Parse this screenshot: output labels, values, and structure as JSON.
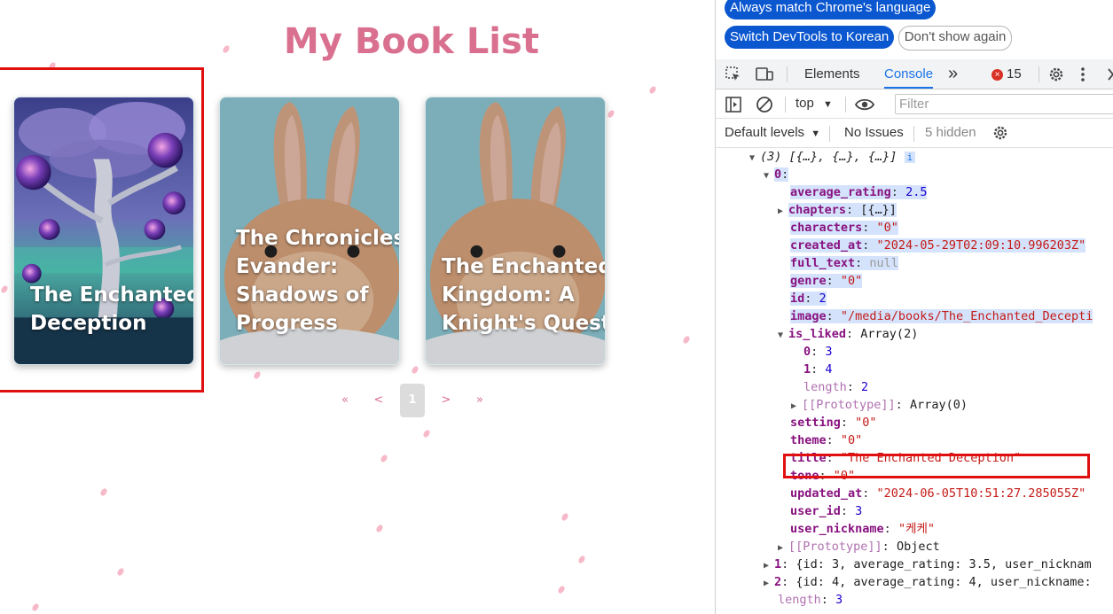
{
  "app": {
    "title": "My Book List",
    "books": [
      {
        "title": "The Enchanted\nDeception",
        "cover": "fantasy-tree-cover"
      },
      {
        "title": "The Chronicles of\nEvander:\nShadows of\nProgress",
        "cover": "rabbit-cover"
      },
      {
        "title": "The Enchanted\nKingdom: A\nKnight's Quest",
        "cover": "rabbit-cover"
      }
    ],
    "pagination": {
      "first": "«",
      "prev": "<",
      "current": "1",
      "next": ">",
      "last": "»"
    }
  },
  "devtools": {
    "banner": {
      "always_match": "Always match Chrome's language",
      "switch_korean": "Switch DevTools to Korean",
      "dont_show": "Don't show again"
    },
    "tabs": {
      "elements": "Elements",
      "console": "Console",
      "more": "»",
      "error_count": "15"
    },
    "toolbar": {
      "context": "top",
      "filter_placeholder": "Filter"
    },
    "levels": {
      "default_levels": "Default levels",
      "no_issues": "No Issues",
      "hidden": "5 hidden"
    },
    "console": {
      "array_summary": "(3) [{…}, {…}, {…}]",
      "index0": "0",
      "props": [
        {
          "key": "average_rating",
          "value": "2.5",
          "kind": "num"
        },
        {
          "key": "chapters",
          "value": "[{…}]",
          "kind": "obj",
          "expandable": true
        },
        {
          "key": "characters",
          "value": "\"0\"",
          "kind": "str"
        },
        {
          "key": "created_at",
          "value": "\"2024-05-29T02:09:10.996203Z\"",
          "kind": "str"
        },
        {
          "key": "full_text",
          "value": "null",
          "kind": "nul"
        },
        {
          "key": "genre",
          "value": "\"0\"",
          "kind": "str"
        },
        {
          "key": "id",
          "value": "2",
          "kind": "num"
        },
        {
          "key": "image",
          "value": "\"/media/books/The_Enchanted_Decepti",
          "kind": "str"
        }
      ],
      "is_liked": {
        "key": "is_liked",
        "value": "Array(2)",
        "items": [
          {
            "key": "0",
            "value": "3"
          },
          {
            "key": "1",
            "value": "4"
          },
          {
            "key": "length",
            "value": "2"
          }
        ],
        "prototype": "[[Prototype]]",
        "prototype_value": "Array(0)"
      },
      "props2": [
        {
          "key": "setting",
          "value": "\"0\"",
          "kind": "str"
        },
        {
          "key": "theme",
          "value": "\"0\"",
          "kind": "str"
        },
        {
          "key": "title",
          "value": "\"The Enchanted Deception\"",
          "kind": "str"
        },
        {
          "key": "tone",
          "value": "\"0\"",
          "kind": "str"
        },
        {
          "key": "updated_at",
          "value": "\"2024-06-05T10:51:27.285055Z\"",
          "kind": "str"
        },
        {
          "key": "user_id",
          "value": "3",
          "kind": "num"
        },
        {
          "key": "user_nickname",
          "value": "\"케케\"",
          "kind": "str"
        }
      ],
      "obj_prototype": "[[Prototype]]",
      "obj_prototype_value": "Object",
      "row1": {
        "index": "1",
        "text": "{id: 3, average_rating: 3.5, user_nicknam"
      },
      "row2": {
        "index": "2",
        "text": "{id: 4, average_rating: 4, user_nickname:"
      },
      "length": {
        "key": "length",
        "value": "3"
      }
    }
  },
  "colors": {
    "accent_pink": "#d9708f",
    "chrome_blue": "#0b57d0",
    "highlight_red": "#e01010"
  }
}
